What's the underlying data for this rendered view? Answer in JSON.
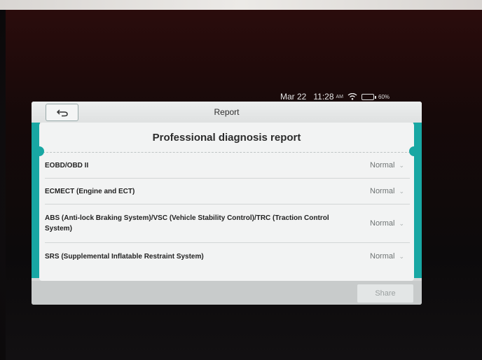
{
  "status_bar": {
    "date": "Mar 22",
    "time": "11:28",
    "time_suffix": "AM",
    "battery_percent": "60%",
    "battery_level": 0.6,
    "icons": [
      "wifi-icon",
      "battery-icon"
    ]
  },
  "header": {
    "title": "Report",
    "back_icon": "back-arrow-icon"
  },
  "report": {
    "title": "Professional diagnosis report",
    "rows": [
      {
        "label": "EOBD/OBD II",
        "status": "Normal"
      },
      {
        "label": "ECMECT (Engine and ECT)",
        "status": "Normal"
      },
      {
        "label": "ABS (Anti-lock Braking System)/VSC (Vehicle Stability Control)/TRC (Traction Control System)",
        "status": "Normal"
      },
      {
        "label": "SRS (Supplemental Inflatable Restraint System)",
        "status": "Normal"
      }
    ]
  },
  "footer": {
    "share_label": "Share"
  },
  "colors": {
    "accent": "#18a7a3",
    "battery": "#2ecc40"
  }
}
